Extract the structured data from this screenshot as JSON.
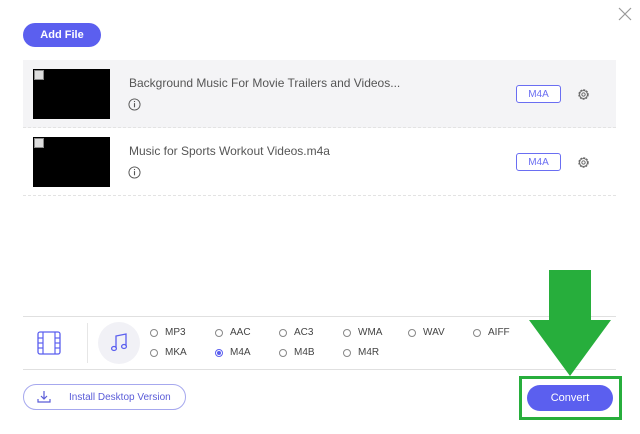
{
  "header": {
    "add_file_label": "Add File",
    "close_icon": "close-icon"
  },
  "files": [
    {
      "name": "Background Music For Movie Trailers and Videos...",
      "format": "M4A",
      "selected": true
    },
    {
      "name": "Music for Sports Workout Videos.m4a",
      "format": "M4A",
      "selected": false
    }
  ],
  "format_panel": {
    "tabs": [
      "video-tab",
      "audio-tab"
    ],
    "active_tab": "audio",
    "options": {
      "mp3": "MP3",
      "aac": "AAC",
      "ac3": "AC3",
      "wma": "WMA",
      "wav": "WAV",
      "aiff": "AIFF",
      "mka": "MKA",
      "m4a": "M4A",
      "m4b": "M4B",
      "m4r": "M4R"
    },
    "selected": "M4A"
  },
  "footer": {
    "install_label": "Install Desktop Version",
    "convert_label": "Convert"
  },
  "colors": {
    "accent": "#5b5fef",
    "annotation_green": "#27ae3c"
  }
}
